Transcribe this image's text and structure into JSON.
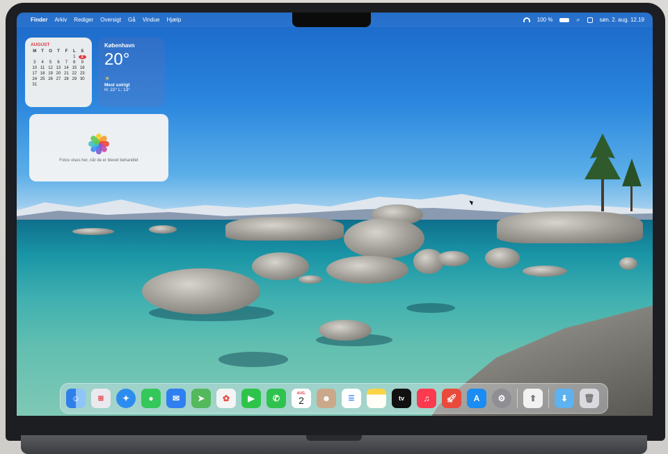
{
  "menubar": {
    "items": [
      "Finder",
      "Arkiv",
      "Rediger",
      "Oversigt",
      "Gå",
      "Vindue",
      "Hjælp"
    ],
    "battery": "100 %",
    "datetime": "søn. 2. aug.  12.19"
  },
  "calendar_widget": {
    "month": "AUGUST",
    "weekdays": [
      "M",
      "T",
      "O",
      "T",
      "F",
      "L",
      "S"
    ],
    "days": [
      "",
      "",
      "",
      "",
      "",
      "1",
      "2",
      "3",
      "4",
      "5",
      "6",
      "7",
      "8",
      "9",
      "10",
      "11",
      "12",
      "13",
      "14",
      "15",
      "16",
      "17",
      "18",
      "19",
      "20",
      "21",
      "22",
      "23",
      "24",
      "25",
      "26",
      "27",
      "28",
      "29",
      "30",
      "31",
      "",
      "",
      "",
      "",
      "",
      ""
    ],
    "today": "2"
  },
  "weather_widget": {
    "city": "København",
    "temp": "20°",
    "condition": "Mest solrigt",
    "high_low": "H: 22° L: 13°"
  },
  "photos_widget": {
    "text": "Fotos vises her, når de er blevet behandlet"
  },
  "dock": {
    "apps": [
      {
        "name": "finder",
        "color": "#3b8ff0"
      },
      {
        "name": "launchpad",
        "color": "#e9e9ee"
      },
      {
        "name": "safari",
        "color": "#2d8cf0"
      },
      {
        "name": "messages",
        "color": "#34c759"
      },
      {
        "name": "mail",
        "color": "#2f7ff0"
      },
      {
        "name": "maps",
        "color": "#53b95c"
      },
      {
        "name": "photos",
        "color": "#f4f4f4"
      },
      {
        "name": "facetime",
        "color": "#2ec44a"
      },
      {
        "name": "phone",
        "color": "#30c24e"
      },
      {
        "name": "calendar",
        "color": "#ffffff"
      },
      {
        "name": "contacts",
        "color": "#c9a98a"
      },
      {
        "name": "reminders",
        "color": "#ffffff"
      },
      {
        "name": "notes",
        "color": "#fbd446"
      },
      {
        "name": "apple-tv",
        "color": "#111111"
      },
      {
        "name": "music",
        "color": "#fb3a4f"
      },
      {
        "name": "rocket",
        "color": "#e94a3c"
      },
      {
        "name": "app-store",
        "color": "#1b8cf2"
      },
      {
        "name": "system-settings",
        "color": "#8e8e93"
      }
    ],
    "calendar_icon_day": "2",
    "calendar_icon_month": "AUG.",
    "appletv_label": "tv"
  }
}
